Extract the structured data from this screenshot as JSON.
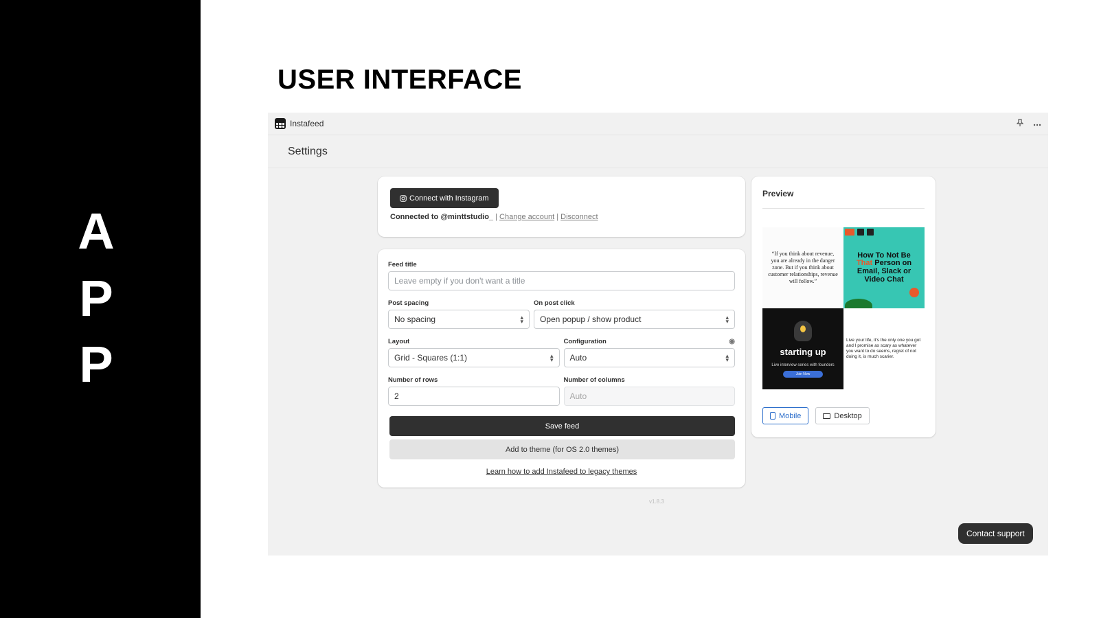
{
  "slide": {
    "side_letters": [
      "A",
      "P",
      "P"
    ],
    "title": "USER INTERFACE"
  },
  "app": {
    "name": "Instafeed",
    "topbar_icons": [
      "pin-icon",
      "more-icon"
    ],
    "page_title": "Settings"
  },
  "connect": {
    "button_label": "Connect with Instagram",
    "connected_prefix": "Connected to @minttstudio_",
    "separator": "|",
    "change_account": "Change account",
    "disconnect": "Disconnect"
  },
  "form": {
    "feed_title_label": "Feed title",
    "feed_title_placeholder": "Leave empty if you don't want a title",
    "post_spacing_label": "Post spacing",
    "post_spacing_value": "No spacing",
    "on_post_click_label": "On post click",
    "on_post_click_value": "Open popup / show product",
    "layout_label": "Layout",
    "layout_value": "Grid - Squares (1:1)",
    "configuration_label": "Configuration",
    "configuration_value": "Auto",
    "rows_label": "Number of rows",
    "rows_value": "2",
    "columns_label": "Number of columns",
    "columns_placeholder": "Auto",
    "save_label": "Save feed",
    "add_theme_label": "Add to theme (for OS 2.0 themes)",
    "learn_link": "Learn how to add Instafeed to legacy themes"
  },
  "version": "v1.8.3",
  "preview": {
    "title": "Preview",
    "tiles": {
      "quote": "“If you think about revenue, you are already in the danger zone. But if you think about customer relationships, revenue will follow.”",
      "teal_line1": "How To Not Be",
      "teal_highlight": "That",
      "teal_line2": "Person on Email, Slack or Video Chat",
      "dark_title": "starting up",
      "dark_sub": "Live interview series with founders",
      "dark_button": "Join Now",
      "text_quote": "Live your life, it's the only one you got and I promise as scary as whatever you want to do seems, regret of not doing it, is much scarier."
    },
    "mobile_label": "Mobile",
    "desktop_label": "Desktop"
  },
  "support_label": "Contact support",
  "colors": {
    "primary_dark": "#303030",
    "accent_blue": "#2c6ecb",
    "teal": "#37c6b3",
    "orange": "#e8592b"
  }
}
